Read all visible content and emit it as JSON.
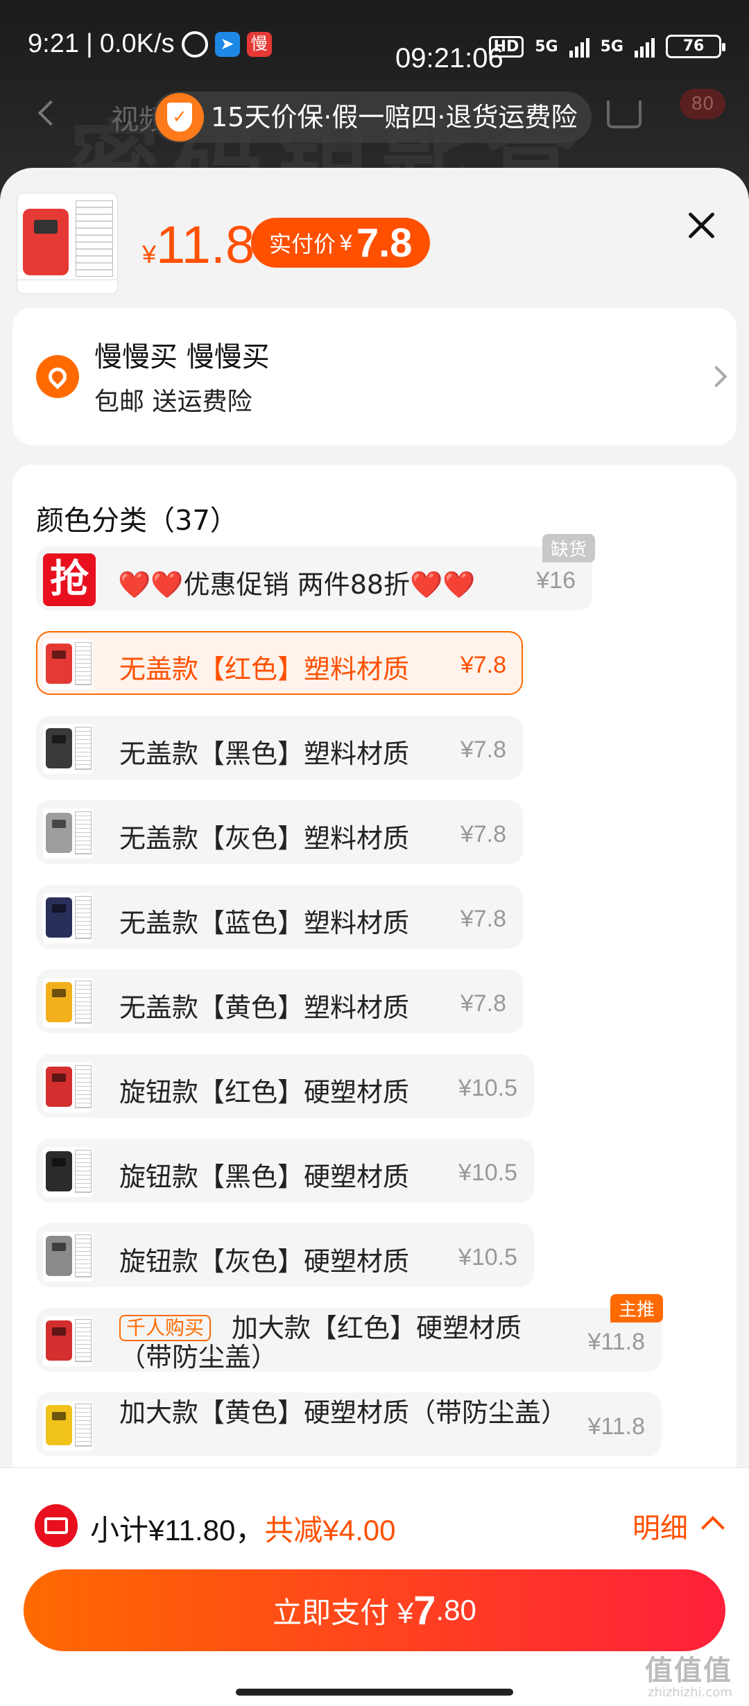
{
  "status_bar": {
    "time": "9:21",
    "net_speed": "0.0K/s",
    "center_time": "09:21:06",
    "hd": "HD",
    "net1": "5G",
    "net2": "5G",
    "battery": "76",
    "app_badge": "慢"
  },
  "background": {
    "tab": "视频",
    "cart_badge": "80",
    "watermark_text": "密码钥匙盒"
  },
  "guarantee_text": "15天价保·假一赔四·退货运费险",
  "product": {
    "currency": "¥",
    "price": "11.8",
    "paid_label": "实付价",
    "paid_currency": "¥",
    "paid_price": "7.8"
  },
  "address": {
    "name": "慢慢买 慢慢买",
    "sub": "包邮 送运费险"
  },
  "sku_section": {
    "title": "颜色分类（37）",
    "promo": {
      "icon_text": "抢",
      "label": "❤️❤️优惠促销 两件88折❤️❤️",
      "price": "¥16",
      "badge": "缺货"
    },
    "items": [
      {
        "label": "无盖款【红色】塑料材质",
        "price": "¥7.8",
        "color": "#e53935"
      },
      {
        "label": "无盖款【黑色】塑料材质",
        "price": "¥7.8",
        "color": "#3a3a3a"
      },
      {
        "label": "无盖款【灰色】塑料材质",
        "price": "¥7.8",
        "color": "#9e9e9e"
      },
      {
        "label": "无盖款【蓝色】塑料材质",
        "price": "¥7.8",
        "color": "#2a2f5a"
      },
      {
        "label": "无盖款【黄色】塑料材质",
        "price": "¥7.8",
        "color": "#f2b11c"
      },
      {
        "label": "旋钮款【红色】硬塑材质",
        "price": "¥10.5",
        "color": "#d32f2f"
      },
      {
        "label": "旋钮款【黑色】硬塑材质",
        "price": "¥10.5",
        "color": "#2b2b2b"
      },
      {
        "label": "旋钮款【灰色】硬塑材质",
        "price": "¥10.5",
        "color": "#8a8a8a"
      }
    ],
    "big_red": {
      "tag": "千人购买",
      "label": "加大款【红色】硬塑材质（带防尘盖）",
      "price": "¥11.8",
      "badge": "主推",
      "color": "#d32f2f"
    },
    "big_yellow": {
      "label": "加大款【黄色】硬塑材质（带防尘盖）",
      "price": "¥11.8",
      "color": "#f2c21c"
    }
  },
  "bottom": {
    "subtotal": "小计¥11.80，",
    "reduce": "共减¥4.00",
    "detail": "明细",
    "pay_label": "立即支付 ¥",
    "pay_big": "7",
    "pay_small": ".80"
  },
  "watermark": {
    "logo": "值值值",
    "url": "zhizhizhi.com"
  }
}
